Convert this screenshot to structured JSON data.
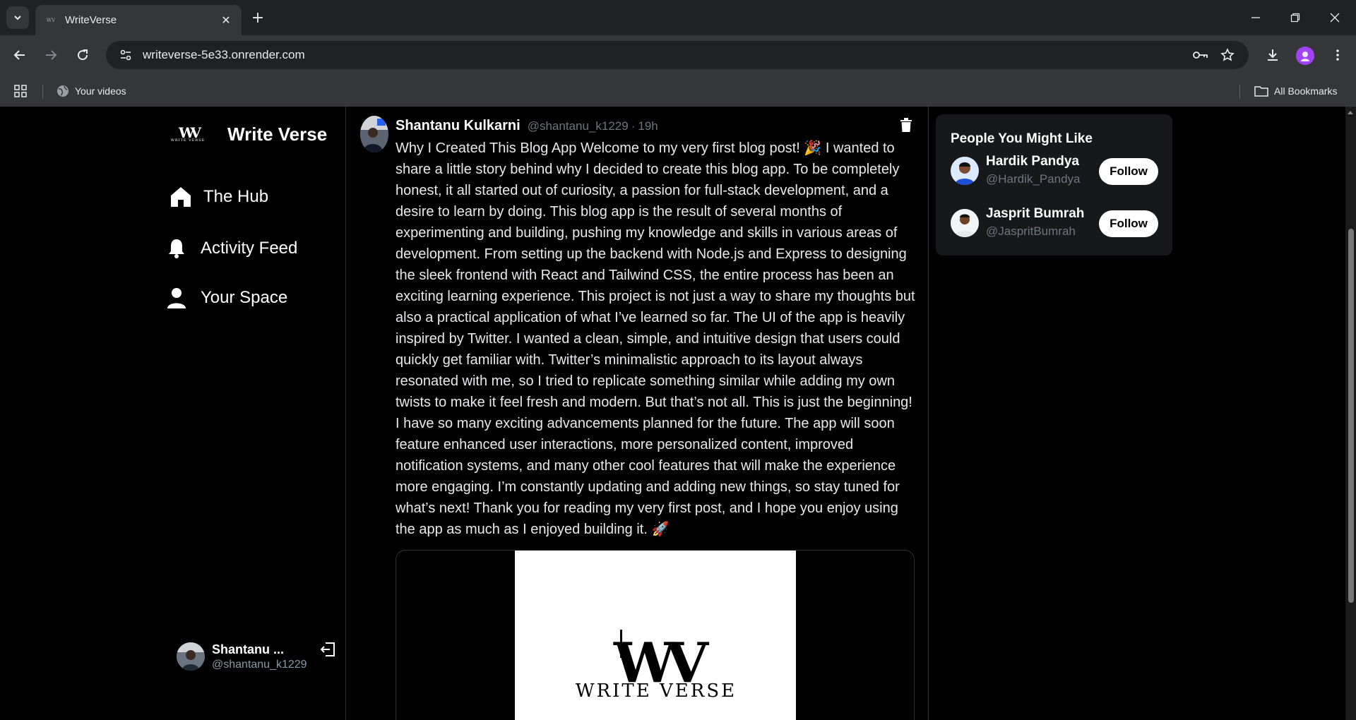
{
  "browser": {
    "tab_title": "WriteVerse",
    "favicon_text": "WV",
    "url": "writeverse-5e33.onrender.com",
    "bookmarks": [
      {
        "label": "Your videos"
      }
    ],
    "all_bookmarks_label": "All Bookmarks"
  },
  "sidebar": {
    "brand_logo_big": "WV",
    "brand_logo_small": "WRITE VERSE",
    "brand_name": "Write Verse",
    "nav": [
      {
        "label": "The Hub",
        "icon": "home-icon"
      },
      {
        "label": "Activity Feed",
        "icon": "bell-icon"
      },
      {
        "label": "Your Space",
        "icon": "user-icon"
      }
    ],
    "user": {
      "name": "Shantanu ...",
      "handle": "@shantanu_k1229"
    }
  },
  "post": {
    "author": "Shantanu Kulkarni",
    "handle": "@shantanu_k1229",
    "separator": "·",
    "time": "19h",
    "body": "Why I Created This Blog App Welcome to my very first blog post! 🎉 I wanted to share a little story behind why I decided to create this blog app. To be completely honest, it all started out of curiosity, a passion for full-stack development, and a desire to learn by doing. This blog app is the result of several months of experimenting and building, pushing my knowledge and skills in various areas of development. From setting up the backend with Node.js and Express to designing the sleek frontend with React and Tailwind CSS, the entire process has been an exciting learning experience. This project is not just a way to share my thoughts but also a practical application of what I’ve learned so far. The UI of the app is heavily inspired by Twitter. I wanted a clean, simple, and intuitive design that users could quickly get familiar with. Twitter’s minimalistic approach to its layout always resonated with me, so I tried to replicate something similar while adding my own twists to make it feel fresh and modern. But that’s not all. This is just the beginning! I have so many exciting advancements planned for the future. The app will soon feature enhanced user interactions, more personalized content, improved notification systems, and many other cool features that will make the experience more engaging. I’m constantly updating and adding new things, so stay tuned for what’s next! Thank you for reading my very first post, and I hope you enjoy using the app as much as I enjoyed building it. 🚀",
    "image_logo_big": "WV",
    "image_logo_small": "WRITE VERSE"
  },
  "suggestions": {
    "title": "People You Might Like",
    "people": [
      {
        "name": "Hardik Pandya",
        "handle": "@Hardik_Pandya",
        "button": "Follow"
      },
      {
        "name": "Jasprit Bumrah",
        "handle": "@JaspritBumrah",
        "button": "Follow"
      }
    ]
  },
  "colors": {
    "background": "#000000",
    "panel": "#16181c",
    "muted_text": "#6e767d",
    "browser_chrome": "#35363a",
    "profile_accent": "#a142f4"
  }
}
